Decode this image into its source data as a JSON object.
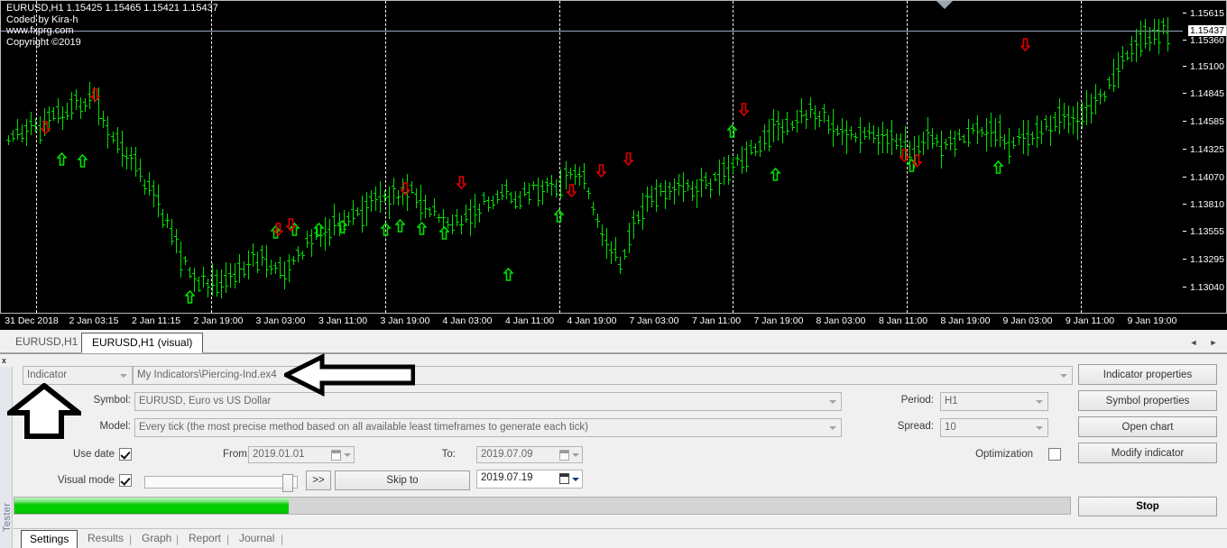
{
  "chart": {
    "header_lines": [
      "EURUSD,H1  1.15425 1.15465 1.15421 1.15437",
      "Coded by Kira-h",
      "www.fxprg.com",
      "Copyright ©2019"
    ],
    "symbol_line": "EURUSD,H1  1.15425 1.15465 1.15421 1.15437",
    "author": "Coded by Kira-h",
    "website": "www.fxprg.com",
    "copyright": "Copyright ©2019",
    "current_price_label": "1.15437",
    "price_labels": [
      "1.15615",
      "1.15360",
      "1.15100",
      "1.14845",
      "1.14585",
      "1.14325",
      "1.14070",
      "1.13810",
      "1.13555",
      "1.13295",
      "1.13040"
    ],
    "time_labels": [
      "31 Dec 2018",
      "2 Jan 03:15",
      "2 Jan 11:15",
      "2 Jan 19:00",
      "3 Jan 03:00",
      "3 Jan 11:00",
      "3 Jan 19:00",
      "4 Jan 03:00",
      "4 Jan 11:00",
      "4 Jan 19:00",
      "7 Jan 03:00",
      "7 Jan 11:00",
      "7 Jan 19:00",
      "8 Jan 03:00",
      "8 Jan 11:00",
      "8 Jan 19:00",
      "9 Jan 03:00",
      "9 Jan 11:00",
      "9 Jan 19:00"
    ],
    "bar_color": "#00e000",
    "sell_marker_color": "#e00000",
    "buy_marker_color": "#00e000",
    "background": "#000000"
  },
  "chart_tabs": {
    "items": [
      {
        "label": "EURUSD,H1",
        "active": false
      },
      {
        "label": "EURUSD,H1 (visual)",
        "active": true
      }
    ],
    "scroll_left": "◄",
    "scroll_right": "►"
  },
  "tester": {
    "close_label": "x",
    "side_label": "Tester",
    "mode_select": {
      "value": "Indicator"
    },
    "program_path": {
      "value": "My Indicators\\Piercing-Ind.ex4"
    },
    "symbol": {
      "label": "Symbol:",
      "value": "EURUSD, Euro vs US Dollar"
    },
    "model": {
      "label": "Model:",
      "value": "Every tick (the most precise method based on all available least timeframes to generate each tick)"
    },
    "period": {
      "label": "Period:",
      "value": "H1"
    },
    "spread": {
      "label": "Spread:",
      "value": "10"
    },
    "use_date": {
      "label": "Use date",
      "checked": true
    },
    "from": {
      "label": "From:",
      "value": "2019.01.01"
    },
    "to": {
      "label": "To:",
      "value": "2019.07.09"
    },
    "visual_mode": {
      "label": "Visual mode",
      "checked": true
    },
    "skip_to_button": "Skip to",
    "skip_to_date": "2019.07.19",
    "fast_forward_button": ">>",
    "optimization": {
      "label": "Optimization",
      "checked": false
    },
    "buttons": {
      "indicator_properties": "Indicator properties",
      "symbol_properties": "Symbol properties",
      "open_chart": "Open chart",
      "modify_indicator": "Modify indicator",
      "stop": "Stop"
    },
    "progress_percent": 26,
    "bottom_tabs": [
      {
        "label": "Settings",
        "active": true
      },
      {
        "label": "Results",
        "active": false
      },
      {
        "label": "Graph",
        "active": false
      },
      {
        "label": "Report",
        "active": false
      },
      {
        "label": "Journal",
        "active": false
      }
    ],
    "tab_separator": "|"
  },
  "annotations": {
    "arrow_left_target": "program-path-field",
    "arrow_up_target": "mode-select"
  }
}
